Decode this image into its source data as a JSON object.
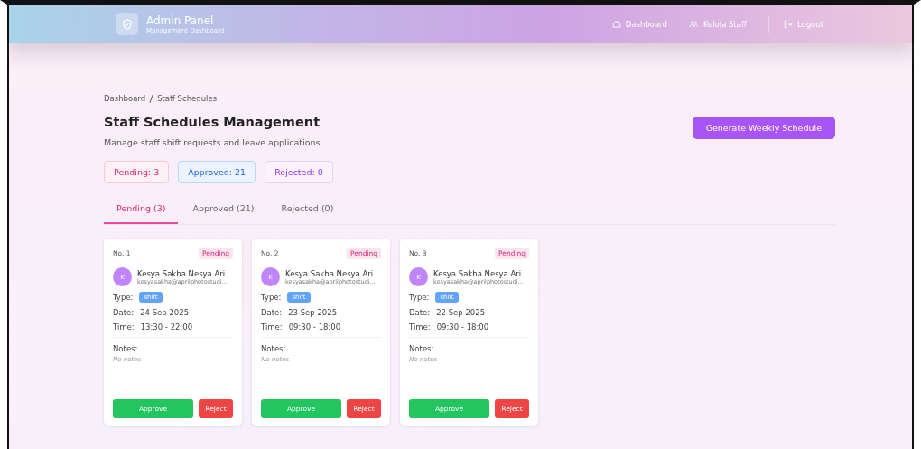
{
  "header": {
    "title": "Admin Panel",
    "subtitle": "Management Dashboard",
    "nav": [
      {
        "label": "Dashboard",
        "kind": "briefcase"
      },
      {
        "label": "Kelola Staff",
        "kind": "people"
      },
      {
        "label": "Logout",
        "kind": "logout"
      }
    ]
  },
  "breadcrumb": [
    "Dashboard",
    "Staff Schedules"
  ],
  "page": {
    "title": "Staff Schedules Management",
    "subtitle": "Manage staff shift requests and leave applications",
    "action": "Generate Weekly Schedule"
  },
  "stats": [
    {
      "label": "Pending: 3",
      "kind": "pending"
    },
    {
      "label": "Approved: 21",
      "kind": "approved"
    },
    {
      "label": "Rejected: 0",
      "kind": "rejected"
    }
  ],
  "tabs": [
    {
      "label": "Pending (3)",
      "selected": true
    },
    {
      "label": "Approved (21)",
      "selected": false
    },
    {
      "label": "Rejected (0)",
      "selected": false
    }
  ],
  "cards": [
    {
      "number": "No. 1",
      "status": "Pending",
      "kind": "pending",
      "initial": "K",
      "name": "Kesya Sakha Nesya Ari...",
      "email": "kesyasakha@aprilphotostudi...",
      "type_label": "Type:",
      "type": "shift",
      "date_label": "Date:",
      "date": "24 Sep 2025",
      "time_label": "Time:",
      "time": "13:30 - 22:00",
      "notes_label": "Notes:",
      "notes": "No notes",
      "approve": "Approve",
      "reject": "Reject"
    },
    {
      "number": "No. 2",
      "status": "Pending",
      "kind": "pending",
      "initial": "K",
      "name": "Kesya Sakha Nesya Ari...",
      "email": "kesyasakha@aprilphotostudi...",
      "type_label": "Type:",
      "type": "shift",
      "date_label": "Date:",
      "date": "23 Sep 2025",
      "time_label": "Time:",
      "time": "09:30 - 18:00",
      "notes_label": "Notes:",
      "notes": "No notes",
      "approve": "Approve",
      "reject": "Reject"
    },
    {
      "number": "No. 3",
      "status": "Pending",
      "kind": "pending",
      "initial": "K",
      "name": "Kesya Sakha Nesya Ari...",
      "email": "kesyasakha@aprilphotostudi...",
      "type_label": "Type:",
      "type": "shift",
      "date_label": "Date:",
      "date": "22 Sep 2025",
      "time_label": "Time:",
      "time": "09:30 - 18:00",
      "notes_label": "Notes:",
      "notes": "No notes",
      "approve": "Approve",
      "reject": "Reject"
    }
  ]
}
